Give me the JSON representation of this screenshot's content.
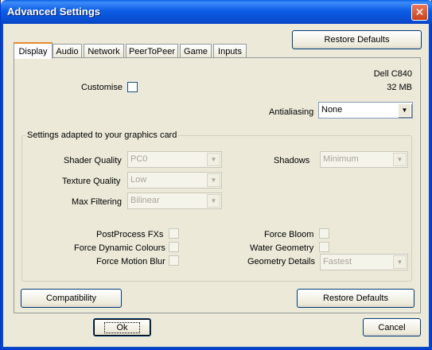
{
  "window": {
    "title": "Advanced Settings",
    "close_glyph": "✕"
  },
  "top": {
    "restore_defaults_label": "Restore Defaults"
  },
  "tabs": [
    {
      "label": "Display",
      "active": true
    },
    {
      "label": "Audio"
    },
    {
      "label": "Network"
    },
    {
      "label": "PeerToPeer"
    },
    {
      "label": "Game"
    },
    {
      "label": "Inputs"
    }
  ],
  "display": {
    "gpu_name": "Dell C840",
    "gpu_memory": "32 MB",
    "customise_label": "Customise",
    "antialiasing_label": "Antialiasing",
    "antialiasing_value": "None",
    "group_title": "Settings adapted to your graphics card",
    "shader_quality_label": "Shader Quality",
    "shader_quality_value": "PC0",
    "texture_quality_label": "Texture Quality",
    "texture_quality_value": "Low",
    "max_filtering_label": "Max Filtering",
    "max_filtering_value": "Bilinear",
    "shadows_label": "Shadows",
    "shadows_value": "Minimum",
    "postprocess_label": "PostProcess FXs",
    "dynamic_colours_label": "Force Dynamic Colours",
    "motion_blur_label": "Force Motion Blur",
    "bloom_label": "Force Bloom",
    "water_label": "Water Geometry",
    "geometry_details_label": "Geometry Details",
    "geometry_details_value": "Fastest"
  },
  "panel_buttons": {
    "compatibility_label": "Compatibility",
    "restore_defaults_label": "Restore Defaults"
  },
  "dialog_buttons": {
    "ok_label": "Ok",
    "cancel_label": "Cancel"
  },
  "icons": {
    "dropdown_arrow": "▼"
  }
}
